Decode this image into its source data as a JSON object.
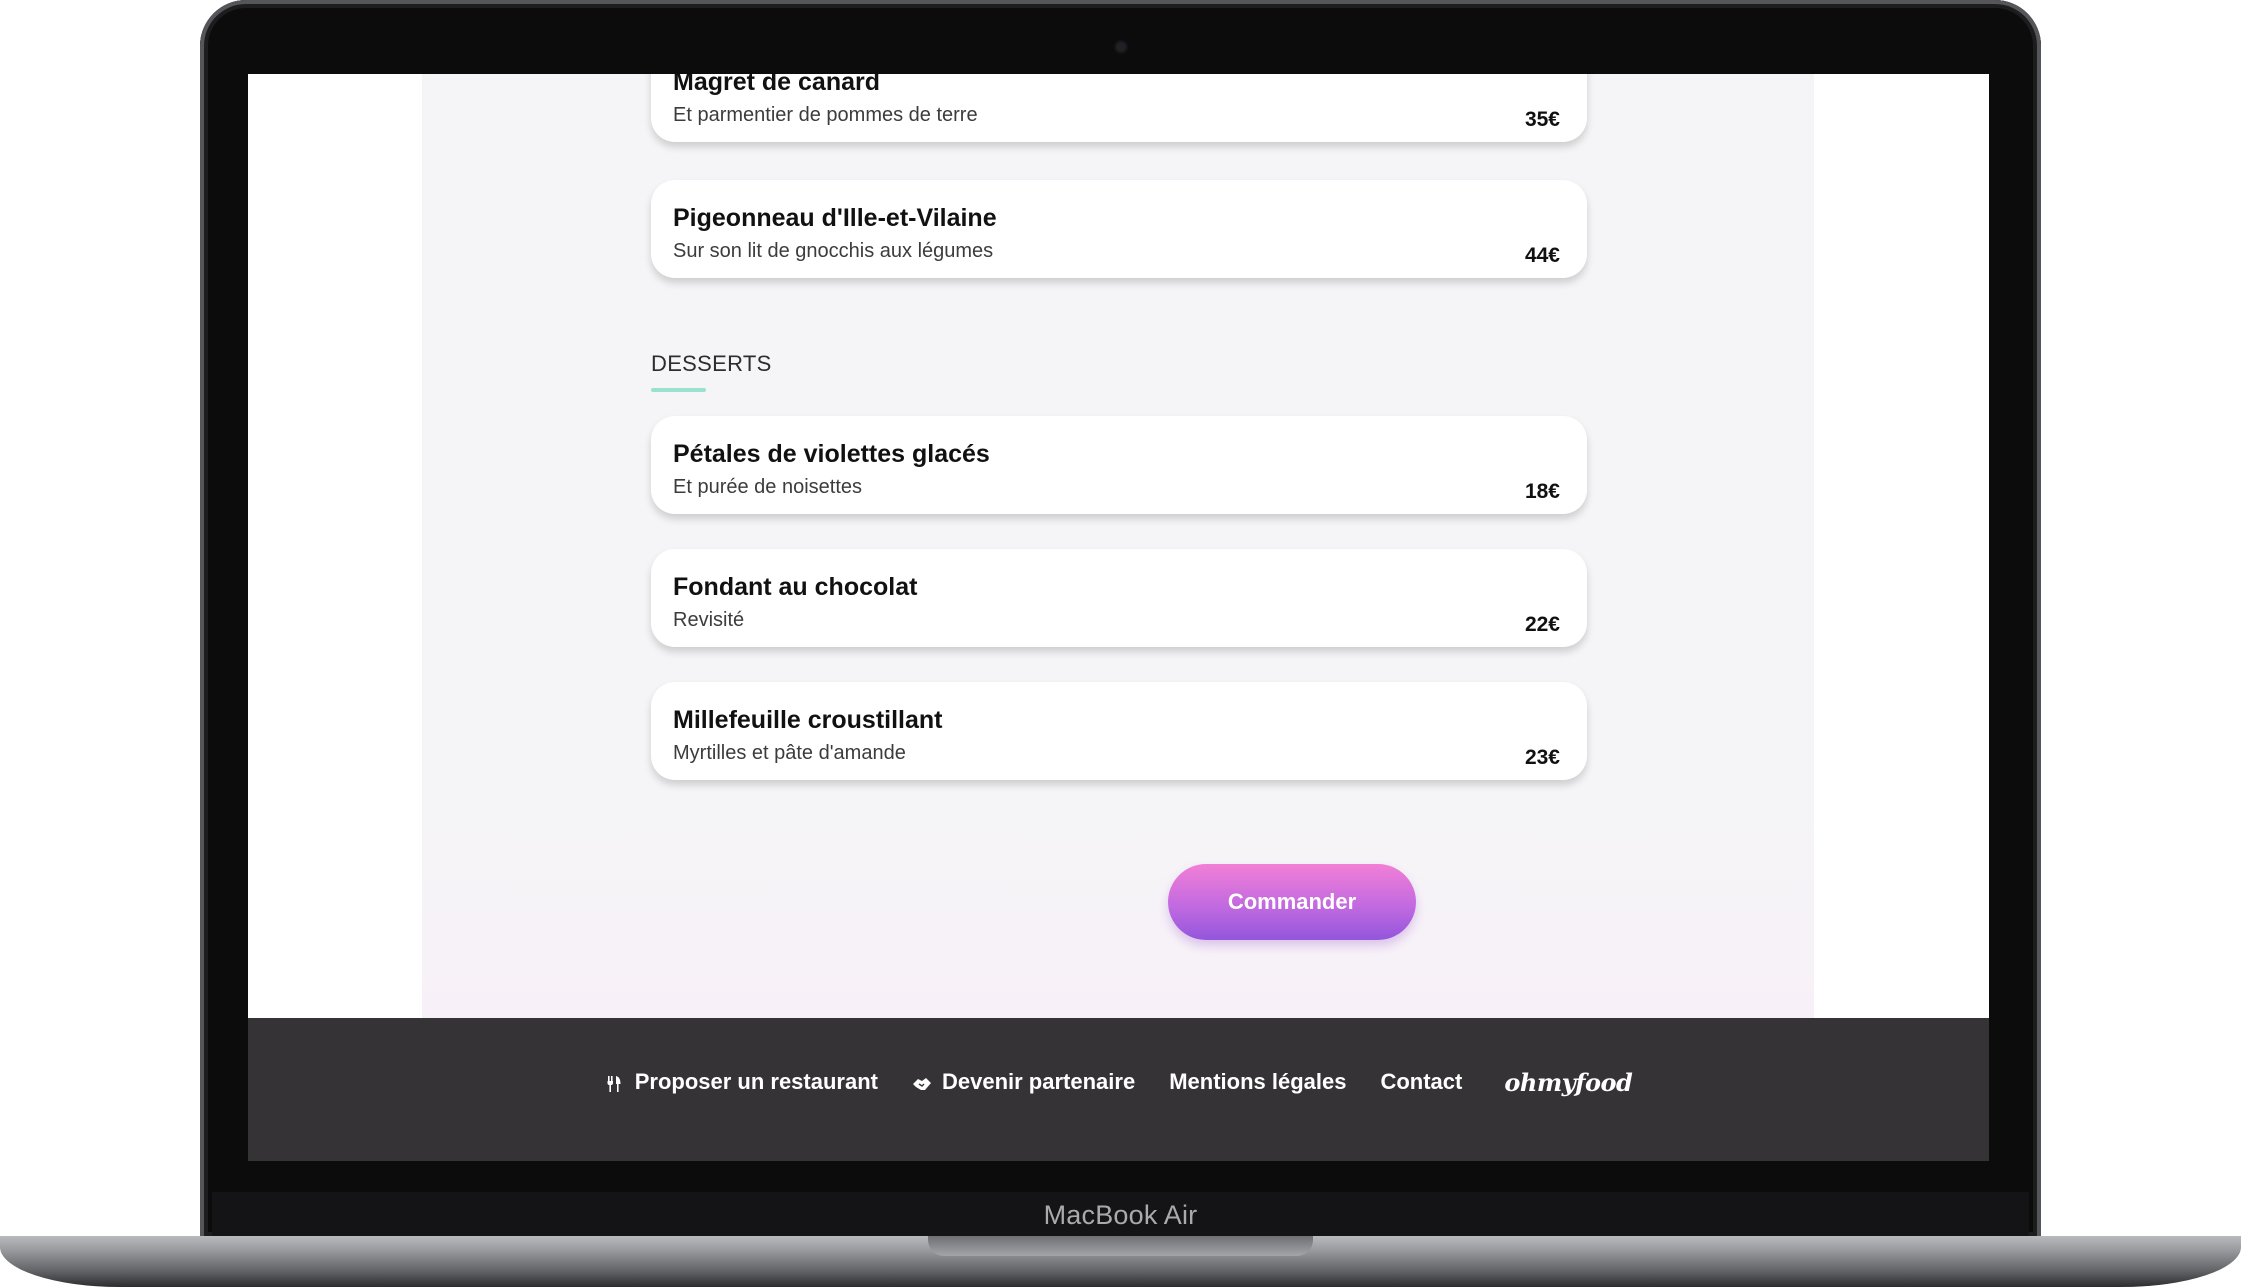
{
  "device": {
    "label": "MacBook Air"
  },
  "menu": {
    "items_top": [
      {
        "title": "Magret de canard",
        "description": "Et parmentier de pommes de terre",
        "price": "35€"
      },
      {
        "title": "Pigeonneau d'Ille-et-Vilaine",
        "description": "Sur son lit de gnocchis aux légumes",
        "price": "44€"
      }
    ],
    "desserts": {
      "title": "DESSERTS",
      "items": [
        {
          "title": "Pétales de violettes glacés",
          "description": "Et purée de noisettes",
          "price": "18€"
        },
        {
          "title": "Fondant au chocolat",
          "description": "Revisité",
          "price": "22€"
        },
        {
          "title": "Millefeuille croustillant",
          "description": "Myrtilles et pâte d'amande",
          "price": "23€"
        }
      ]
    },
    "order_button": "Commander"
  },
  "footer": {
    "links": [
      {
        "label": "Proposer un restaurant",
        "icon": "utensils-icon"
      },
      {
        "label": "Devenir partenaire",
        "icon": "handshake-icon"
      },
      {
        "label": "Mentions légales"
      },
      {
        "label": "Contact"
      }
    ],
    "logo": "ohmyfood"
  },
  "colors": {
    "accent_underline": "#99e2d0",
    "button_gradient_start": "#f27fd6",
    "button_gradient_end": "#9356dc",
    "footer_bg": "#353335"
  }
}
